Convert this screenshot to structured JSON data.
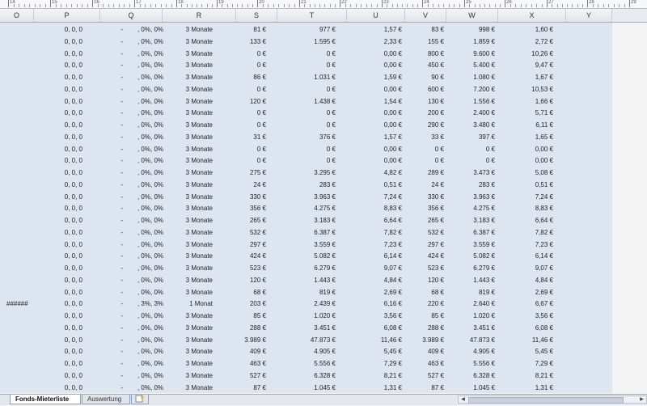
{
  "ruler": [
    "14",
    "15",
    "16",
    "17",
    "18",
    "19",
    "20",
    "21",
    "22",
    "23",
    "24",
    "25",
    "26",
    "27",
    "28",
    "29"
  ],
  "columns": [
    "O",
    "P",
    "Q",
    "R",
    "S",
    "T",
    "U",
    "V",
    "W",
    "X",
    "Y"
  ],
  "rows": [
    [
      "",
      "0, 0, 0",
      "-",
      ", 0%, 0%",
      "3 Monate",
      "81 €",
      "977 €",
      "1,57 €",
      "83 €",
      "998 €",
      "1,60 €"
    ],
    [
      "",
      "0, 0, 0",
      "-",
      ", 0%, 0%",
      "3 Monate",
      "133 €",
      "1.595 €",
      "2,33 €",
      "155 €",
      "1.859 €",
      "2,72 €"
    ],
    [
      "",
      "0, 0, 0",
      "-",
      ", 0%, 0%",
      "3 Monate",
      "0 €",
      "0 €",
      "0,00 €",
      "800 €",
      "9.600 €",
      "10,26 €"
    ],
    [
      "",
      "0, 0, 0",
      "-",
      ", 0%, 0%",
      "3 Monate",
      "0 €",
      "0 €",
      "0,00 €",
      "450 €",
      "5.400 €",
      "9,47 €"
    ],
    [
      "",
      "0, 0, 0",
      "-",
      ", 0%, 0%",
      "3 Monate",
      "86 €",
      "1.031 €",
      "1,59 €",
      "90 €",
      "1.080 €",
      "1,67 €"
    ],
    [
      "",
      "0, 0, 0",
      "-",
      ", 0%, 0%",
      "3 Monate",
      "0 €",
      "0 €",
      "0,00 €",
      "600 €",
      "7.200 €",
      "10,53 €"
    ],
    [
      "",
      "0, 0, 0",
      "-",
      ", 0%, 0%",
      "3 Monate",
      "120 €",
      "1.438 €",
      "1,54 €",
      "130 €",
      "1.556 €",
      "1,66 €"
    ],
    [
      "",
      "0, 0, 0",
      "-",
      ", 0%, 0%",
      "3 Monate",
      "0 €",
      "0 €",
      "0,00 €",
      "200 €",
      "2.400 €",
      "5,71 €"
    ],
    [
      "",
      "0, 0, 0",
      "-",
      ", 0%, 0%",
      "3 Monate",
      "0 €",
      "0 €",
      "0,00 €",
      "290 €",
      "3.480 €",
      "6,11 €"
    ],
    [
      "",
      "0, 0, 0",
      "-",
      ", 0%, 0%",
      "3 Monate",
      "31 €",
      "376 €",
      "1,57 €",
      "33 €",
      "397 €",
      "1,65 €"
    ],
    [
      "",
      "0, 0, 0",
      "-",
      ", 0%, 0%",
      "3 Monate",
      "0 €",
      "0 €",
      "0,00 €",
      "0 €",
      "0 €",
      "0,00 €"
    ],
    [
      "",
      "0, 0, 0",
      "-",
      ", 0%, 0%",
      "3 Monate",
      "0 €",
      "0 €",
      "0,00 €",
      "0 €",
      "0 €",
      "0,00 €"
    ],
    [
      "",
      "0, 0, 0",
      "-",
      ", 0%, 0%",
      "3 Monate",
      "275 €",
      "3.295 €",
      "4,82 €",
      "289 €",
      "3.473 €",
      "5,08 €"
    ],
    [
      "",
      "0, 0, 0",
      "-",
      ", 0%, 0%",
      "3 Monate",
      "24 €",
      "283 €",
      "0,51 €",
      "24 €",
      "283 €",
      "0,51 €"
    ],
    [
      "",
      "0, 0, 0",
      "-",
      ", 0%, 0%",
      "3 Monate",
      "330 €",
      "3.963 €",
      "7,24 €",
      "330 €",
      "3.963 €",
      "7,24 €"
    ],
    [
      "",
      "0, 0, 0",
      "-",
      ", 0%, 0%",
      "3 Monate",
      "356 €",
      "4.275 €",
      "8,83 €",
      "356 €",
      "4.275 €",
      "8,83 €"
    ],
    [
      "",
      "0, 0, 0",
      "-",
      ", 0%, 0%",
      "3 Monate",
      "265 €",
      "3.183 €",
      "6,64 €",
      "265 €",
      "3.183 €",
      "6,64 €"
    ],
    [
      "",
      "0, 0, 0",
      "-",
      ", 0%, 0%",
      "3 Monate",
      "532 €",
      "6.387 €",
      "7,82 €",
      "532 €",
      "6.387 €",
      "7,82 €"
    ],
    [
      "",
      "0, 0, 0",
      "-",
      ", 0%, 0%",
      "3 Monate",
      "297 €",
      "3.559 €",
      "7,23 €",
      "297 €",
      "3.559 €",
      "7,23 €"
    ],
    [
      "",
      "0, 0, 0",
      "-",
      ", 0%, 0%",
      "3 Monate",
      "424 €",
      "5.082 €",
      "6,14 €",
      "424 €",
      "5.082 €",
      "6,14 €"
    ],
    [
      "",
      "0, 0, 0",
      "-",
      ", 0%, 0%",
      "3 Monate",
      "523 €",
      "6.279 €",
      "9,07 €",
      "523 €",
      "6.279 €",
      "9,07 €"
    ],
    [
      "",
      "0, 0, 0",
      "-",
      ", 0%, 0%",
      "3 Monate",
      "120 €",
      "1.443 €",
      "4,84 €",
      "120 €",
      "1.443 €",
      "4,84 €"
    ],
    [
      "",
      "0, 0, 0",
      "-",
      ", 0%, 0%",
      "3 Monate",
      "68 €",
      "819 €",
      "2,69 €",
      "68 €",
      "819 €",
      "2,69 €"
    ],
    [
      "######",
      "0, 0, 0",
      "-",
      ", 3%, 3%",
      "1 Monat",
      "203 €",
      "2.439 €",
      "6,16 €",
      "220 €",
      "2.640 €",
      "6,67 €"
    ],
    [
      "",
      "0, 0, 0",
      "-",
      ", 0%, 0%",
      "3 Monate",
      "85 €",
      "1.020 €",
      "3,56 €",
      "85 €",
      "1.020 €",
      "3,56 €"
    ],
    [
      "",
      "0, 0, 0",
      "-",
      ", 0%, 0%",
      "3 Monate",
      "288 €",
      "3.451 €",
      "6,08 €",
      "288 €",
      "3.451 €",
      "6,08 €"
    ],
    [
      "",
      "0, 0, 0",
      "-",
      ", 0%, 0%",
      "3 Monate",
      "3.989 €",
      "47.873 €",
      "11,46 €",
      "3.989 €",
      "47.873 €",
      "11,46 €"
    ],
    [
      "",
      "0, 0, 0",
      "-",
      ", 0%, 0%",
      "3 Monate",
      "409 €",
      "4.905 €",
      "5,45 €",
      "409 €",
      "4.905 €",
      "5,45 €"
    ],
    [
      "",
      "0, 0, 0",
      "-",
      ", 0%, 0%",
      "3 Monate",
      "463 €",
      "5.556 €",
      "7,29 €",
      "463 €",
      "5.556 €",
      "7,29 €"
    ],
    [
      "",
      "0, 0, 0",
      "-",
      ", 0%, 0%",
      "3 Monate",
      "527 €",
      "6.328 €",
      "8,21 €",
      "527 €",
      "6.328 €",
      "8,21 €"
    ],
    [
      "",
      "0, 0, 0",
      "-",
      ", 0%, 0%",
      "3 Monate",
      "87 €",
      "1.045 €",
      "1,31 €",
      "87 €",
      "1.045 €",
      "1,31 €"
    ]
  ],
  "tabs": [
    {
      "label": "Fonds-Mieterliste",
      "active": true
    },
    {
      "label": "Auswertung",
      "active": false
    }
  ],
  "icons": {
    "new_sheet": "new-sheet-icon",
    "scroll_left": "scroll-left-icon",
    "scroll_right": "scroll-right-icon"
  },
  "colors": {
    "grid_bg": "#dde6f0",
    "header_bg": "#e8ebef",
    "header_border": "#9eb0c7"
  }
}
